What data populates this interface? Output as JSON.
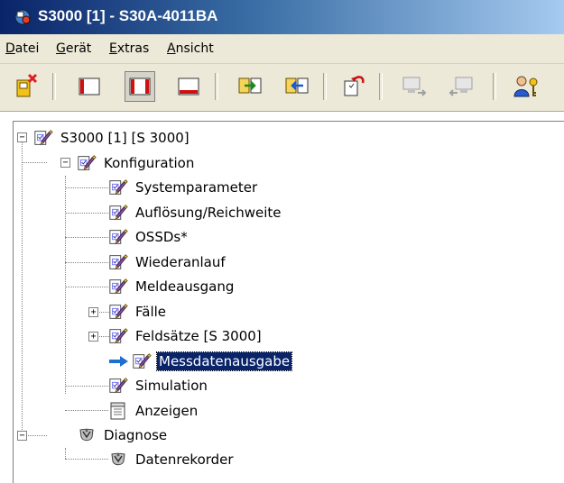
{
  "window": {
    "title": "S3000 [1] - S30A-4011BA"
  },
  "menu": [
    {
      "first": "D",
      "rest": "atei"
    },
    {
      "first": "G",
      "rest": "erät"
    },
    {
      "first": "E",
      "rest": "xtras"
    },
    {
      "first": "A",
      "rest": "nsicht"
    }
  ],
  "toolbar": {
    "buttons": [
      "disconnect",
      "view-left",
      "view-middle-pressed",
      "view-right",
      "upload",
      "download",
      "undo",
      "transfer-left",
      "transfer-right",
      "user-key"
    ]
  },
  "tree": {
    "root": "S3000 [1] [S 3000]",
    "konfiguration": "Konfiguration",
    "systemparameter": "Systemparameter",
    "aufloesung": "Auflösung/Reichweite",
    "ossds": "OSSDs*",
    "wiederanlauf": "Wiederanlauf",
    "meldeausgang": "Meldeausgang",
    "faelle": "Fälle",
    "feldsaetze": "Feldsätze [S 3000]",
    "messdaten": "Messdatenausgabe",
    "simulation": "Simulation",
    "anzeigen": "Anzeigen",
    "diagnose": "Diagnose",
    "datenrekorder": "Datenrekorder"
  },
  "colors": {
    "selection": "#0a246a",
    "title_start": "#0a246a",
    "title_end": "#a6caf0"
  }
}
